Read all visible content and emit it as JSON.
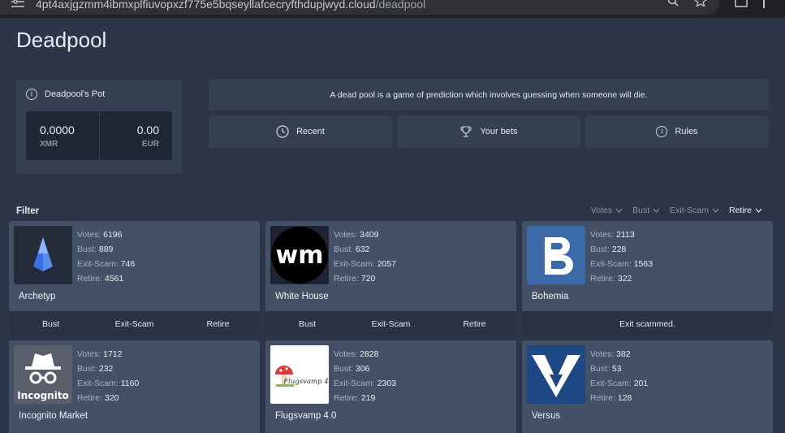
{
  "browser": {
    "url_host": "4pt4axjgzmm4ibmxplfiuvopxzf775e5bqseyllafcecryfthdupjwyd.cloud",
    "url_path": "/deadpool"
  },
  "page": {
    "title": "Deadpool"
  },
  "pot": {
    "label": "Deadpool's Pot",
    "xmr_value": "0.0000",
    "xmr_label": "XMR",
    "eur_value": "0.00",
    "eur_label": "EUR"
  },
  "description": "A dead pool is a game of prediction which involves guessing when someone will die.",
  "nav": [
    {
      "label": "Recent",
      "icon": "clock-icon"
    },
    {
      "label": "Your bets",
      "icon": "trophy-icon"
    },
    {
      "label": "Rules",
      "icon": "info-icon"
    }
  ],
  "filter": {
    "label": "Filter",
    "sorts": [
      {
        "label": "Votes",
        "active": false
      },
      {
        "label": "Bust",
        "active": false
      },
      {
        "label": "Exit-Scam",
        "active": false
      },
      {
        "label": "Retire",
        "active": true
      }
    ]
  },
  "stat_labels": {
    "votes": "Votes:",
    "bust": "Bust:",
    "exit": "Exit-Scam:",
    "retire": "Retire:"
  },
  "markets": [
    {
      "name": "Archetyp",
      "votes": "6196",
      "bust": "889",
      "exit": "746",
      "retire": "4561",
      "actions": [
        "Bust",
        "Exit-Scam",
        "Retire"
      ]
    },
    {
      "name": "White House",
      "votes": "3409",
      "bust": "632",
      "exit": "2057",
      "retire": "720",
      "actions": [
        "Bust",
        "Exit-Scam",
        "Retire"
      ]
    },
    {
      "name": "Bohemia",
      "votes": "2113",
      "bust": "228",
      "exit": "1563",
      "retire": "322",
      "status": "Exit scammed."
    },
    {
      "name": "Incognito Market",
      "logo_text": "Incognito",
      "votes": "1712",
      "bust": "232",
      "exit": "1160",
      "retire": "320"
    },
    {
      "name": "Flugsvamp 4.0",
      "logo_text": "Flugsvamp 4.0",
      "votes": "2828",
      "bust": "306",
      "exit": "2303",
      "retire": "219"
    },
    {
      "name": "Versus",
      "votes": "382",
      "bust": "53",
      "exit": "201",
      "retire": "128"
    }
  ],
  "colors": {
    "background": "#2c3648",
    "card": "#435065",
    "panel": "#353f52",
    "action_bar": "#2a3344"
  }
}
